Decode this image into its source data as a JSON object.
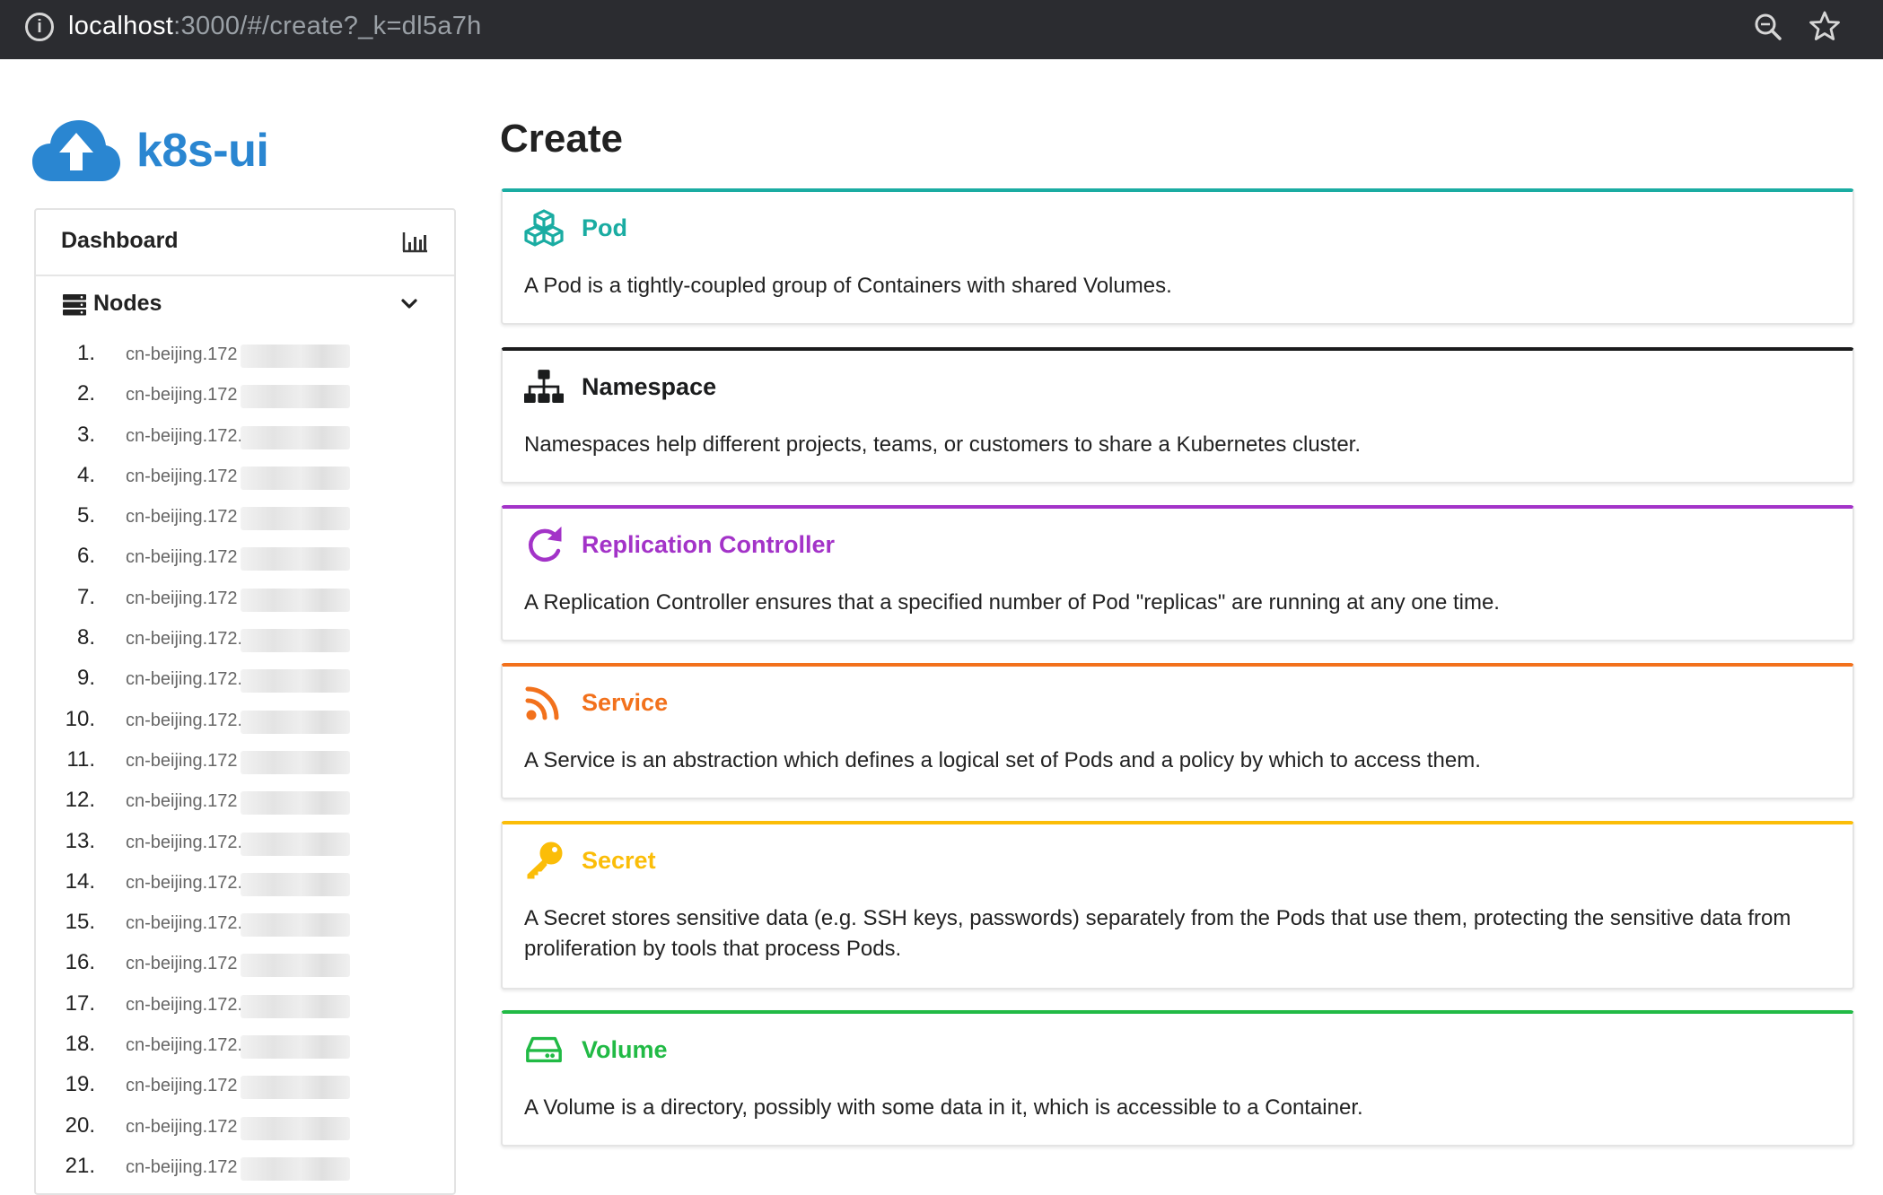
{
  "browser": {
    "url_host": "localhost",
    "url_rest": ":3000/#/create?_k=dl5a7h"
  },
  "brand": {
    "name": "k8s-ui",
    "color": "#2a86d1"
  },
  "sidebar": {
    "dashboard_label": "Dashboard",
    "nodes_label": "Nodes",
    "nodes": [
      {
        "num": "1.",
        "name": "cn-beijing.172"
      },
      {
        "num": "2.",
        "name": "cn-beijing.172"
      },
      {
        "num": "3.",
        "name": "cn-beijing.172.16.2"
      },
      {
        "num": "4.",
        "name": "cn-beijing.172"
      },
      {
        "num": "5.",
        "name": "cn-beijing.172"
      },
      {
        "num": "6.",
        "name": "cn-beijing.172"
      },
      {
        "num": "7.",
        "name": "cn-beijing.172"
      },
      {
        "num": "8.",
        "name": "cn-beijing.172."
      },
      {
        "num": "9.",
        "name": "cn-beijing.172.16.2"
      },
      {
        "num": "10.",
        "name": "cn-beijing.172.16.2"
      },
      {
        "num": "11.",
        "name": "cn-beijing.172"
      },
      {
        "num": "12.",
        "name": "cn-beijing.172"
      },
      {
        "num": "13.",
        "name": "cn-beijing.172."
      },
      {
        "num": "14.",
        "name": "cn-beijing.172."
      },
      {
        "num": "15.",
        "name": "cn-beijing.172.16."
      },
      {
        "num": "16.",
        "name": "cn-beijing.172"
      },
      {
        "num": "17.",
        "name": "cn-beijing.172."
      },
      {
        "num": "18.",
        "name": "cn-beijing.172."
      },
      {
        "num": "19.",
        "name": "cn-beijing.172"
      },
      {
        "num": "20.",
        "name": "cn-beijing.172"
      },
      {
        "num": "21.",
        "name": "cn-beijing.172"
      }
    ]
  },
  "main": {
    "title": "Create",
    "cards": [
      {
        "key": "pod",
        "title": "Pod",
        "icon": "cubes-icon",
        "color": "#1aaca2",
        "description": "A Pod is a tightly-coupled group of Containers with shared Volumes."
      },
      {
        "key": "namespace",
        "title": "Namespace",
        "icon": "sitemap-icon",
        "color": "#1b1c1d",
        "description": "Namespaces help different projects, teams, or customers to share a Kubernetes cluster."
      },
      {
        "key": "replication-controller",
        "title": "Replication Controller",
        "icon": "refresh-icon",
        "color": "#a333c8",
        "description": "A Replication Controller ensures that a specified number of Pod \"replicas\" are running at any one time."
      },
      {
        "key": "service",
        "title": "Service",
        "icon": "rss-icon",
        "color": "#f2711c",
        "description": "A Service is an abstraction which defines a logical set of Pods and a policy by which to access them."
      },
      {
        "key": "secret",
        "title": "Secret",
        "icon": "key-icon",
        "color": "#fbbd08",
        "description": "A Secret stores sensitive data (e.g. SSH keys, passwords) separately from the Pods that use them, protecting the sensitive data from proliferation by tools that process Pods."
      },
      {
        "key": "volume",
        "title": "Volume",
        "icon": "hard-drive-icon",
        "color": "#21ba45",
        "description": "A Volume is a directory, possibly with some data in it, which is accessible to a Container."
      }
    ]
  }
}
